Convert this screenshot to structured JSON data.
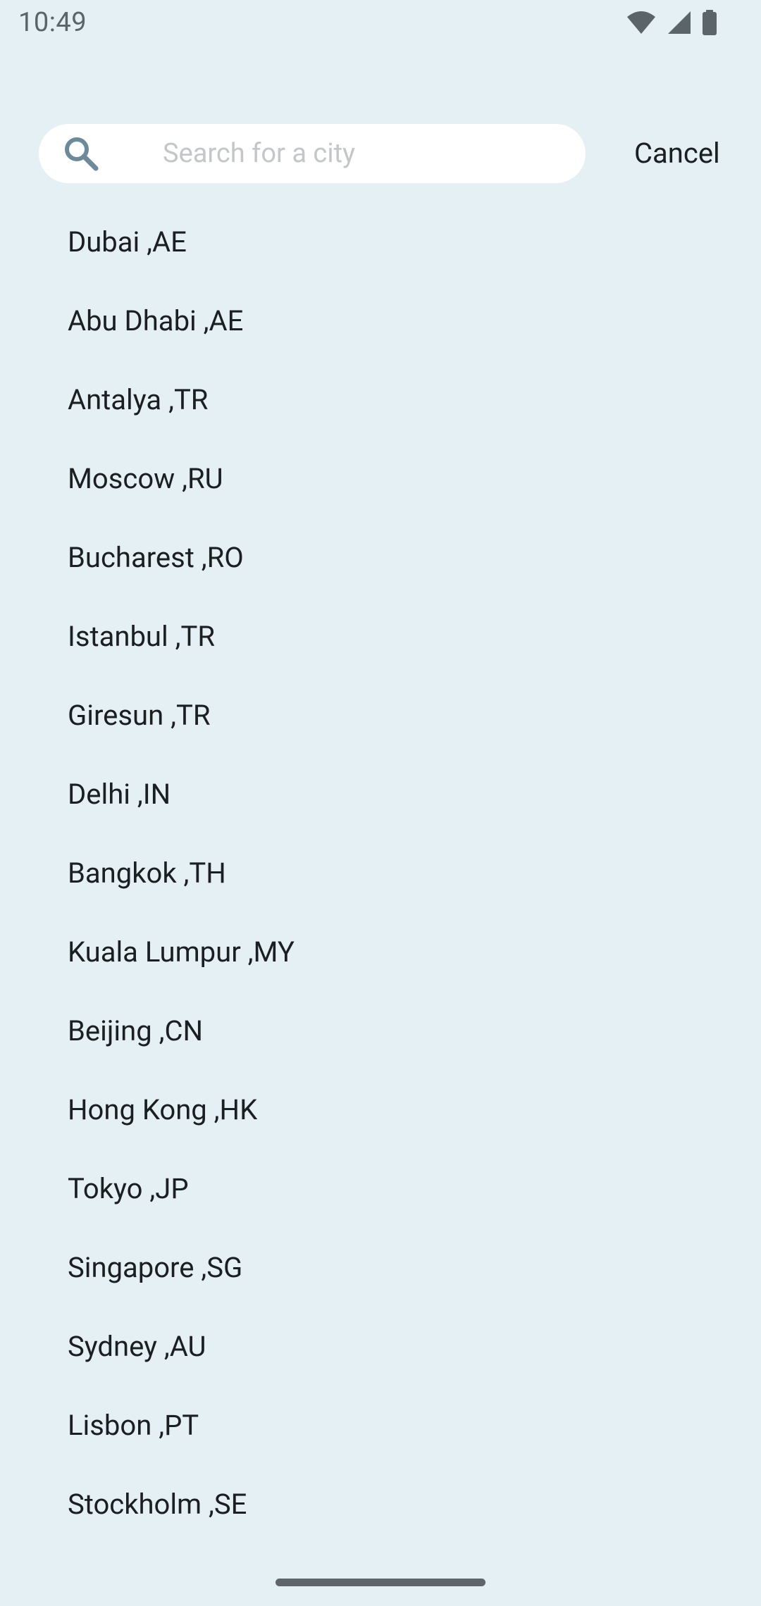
{
  "status_bar": {
    "time": "10:49",
    "icons": [
      "wifi-icon",
      "cellular-signal-icon",
      "battery-icon"
    ]
  },
  "search": {
    "placeholder": "Search for a city",
    "value": "",
    "icon": "search-icon",
    "cancel_label": "Cancel"
  },
  "cities": [
    {
      "label": "Dubai ,AE"
    },
    {
      "label": "Abu Dhabi ,AE"
    },
    {
      "label": "Antalya ,TR"
    },
    {
      "label": "Moscow ,RU"
    },
    {
      "label": "Bucharest ,RO"
    },
    {
      "label": "Istanbul ,TR"
    },
    {
      "label": "Giresun ,TR"
    },
    {
      "label": "Delhi ,IN"
    },
    {
      "label": "Bangkok ,TH"
    },
    {
      "label": "Kuala Lumpur ,MY"
    },
    {
      "label": "Beijing ,CN"
    },
    {
      "label": "Hong Kong ,HK"
    },
    {
      "label": "Tokyo ,JP"
    },
    {
      "label": "Singapore ,SG"
    },
    {
      "label": "Sydney ,AU"
    },
    {
      "label": "Lisbon ,PT"
    },
    {
      "label": "Stockholm ,SE"
    }
  ],
  "colors": {
    "background": "#e5f0f4",
    "search_icon": "#6d8a9a",
    "placeholder": "#c3c7ca",
    "text": "#1c1f21"
  }
}
